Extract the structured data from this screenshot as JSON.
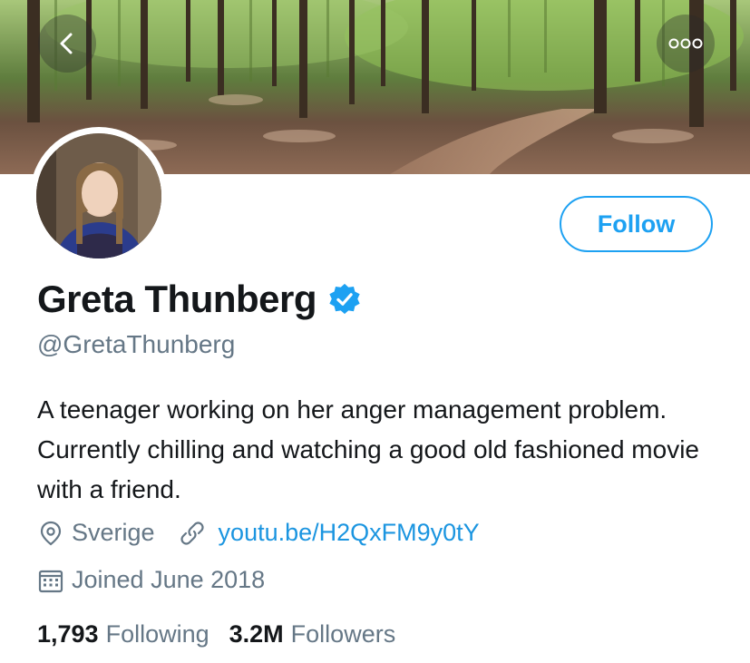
{
  "profile": {
    "name": "Greta Thunberg",
    "handle": "@GretaThunberg",
    "bio": "A teenager working on her anger management problem. Currently chilling and watching a good old fashioned movie with a friend.",
    "location": "Sverige",
    "website": "youtu.be/H2QxFM9y0tY",
    "joined": "Joined June 2018",
    "verified": true
  },
  "actions": {
    "follow_label": "Follow"
  },
  "stats": {
    "following_count": "1,793",
    "following_label": "Following",
    "followers_count": "3.2M",
    "followers_label": "Followers"
  },
  "colors": {
    "accent": "#1da1f2",
    "link": "#1b95e0",
    "secondary_text": "#657786",
    "primary_text": "#14171a"
  },
  "icons": {
    "back": "chevron-left-icon",
    "more": "more-dots-icon",
    "verified": "verified-badge-icon",
    "location": "location-pin-icon",
    "link": "link-icon",
    "calendar": "calendar-icon"
  }
}
